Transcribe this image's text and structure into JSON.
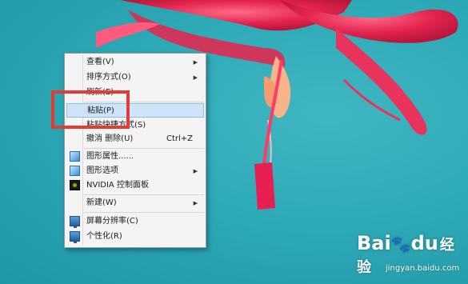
{
  "context_menu": {
    "items": [
      {
        "label": "查看(V)",
        "arrow": "▶",
        "icon": ""
      },
      {
        "label": "排序方式(O)",
        "arrow": "▶",
        "icon": ""
      },
      {
        "label": "刷新(E)",
        "arrow": "",
        "icon": ""
      },
      {
        "label": "粘贴(P)",
        "arrow": "",
        "icon": ""
      },
      {
        "label": "粘贴快捷方式(S)",
        "arrow": "",
        "icon": ""
      },
      {
        "label": "撤消 删除(U)",
        "shortcut": "Ctrl+Z",
        "icon": ""
      },
      {
        "label": "图形属性......",
        "icon": "graphics-properties-icon"
      },
      {
        "label": "图形选项",
        "arrow": "▶",
        "icon": "graphics-options-icon"
      },
      {
        "label": "NVIDIA 控制面板",
        "icon": "nvidia-icon"
      },
      {
        "label": "新建(W)",
        "arrow": "▶",
        "icon": ""
      },
      {
        "label": "屏幕分辨率(C)",
        "icon": "screen-resolution-icon"
      },
      {
        "label": "个性化(R)",
        "icon": "personalize-icon"
      }
    ],
    "highlighted_index": 3
  },
  "annotation": {
    "color": "#e43b35"
  },
  "watermark": {
    "logo_latin": "Bai",
    "logo_paw": "🐾",
    "logo_du": "du",
    "logo_cn": "经验",
    "url": "jingyan.baidu.com"
  },
  "colors": {
    "desktop": "#2ea9b6",
    "menu_bg": "#f4f4f4",
    "highlight": "#cfe4fb",
    "flower": "#e8325a"
  }
}
